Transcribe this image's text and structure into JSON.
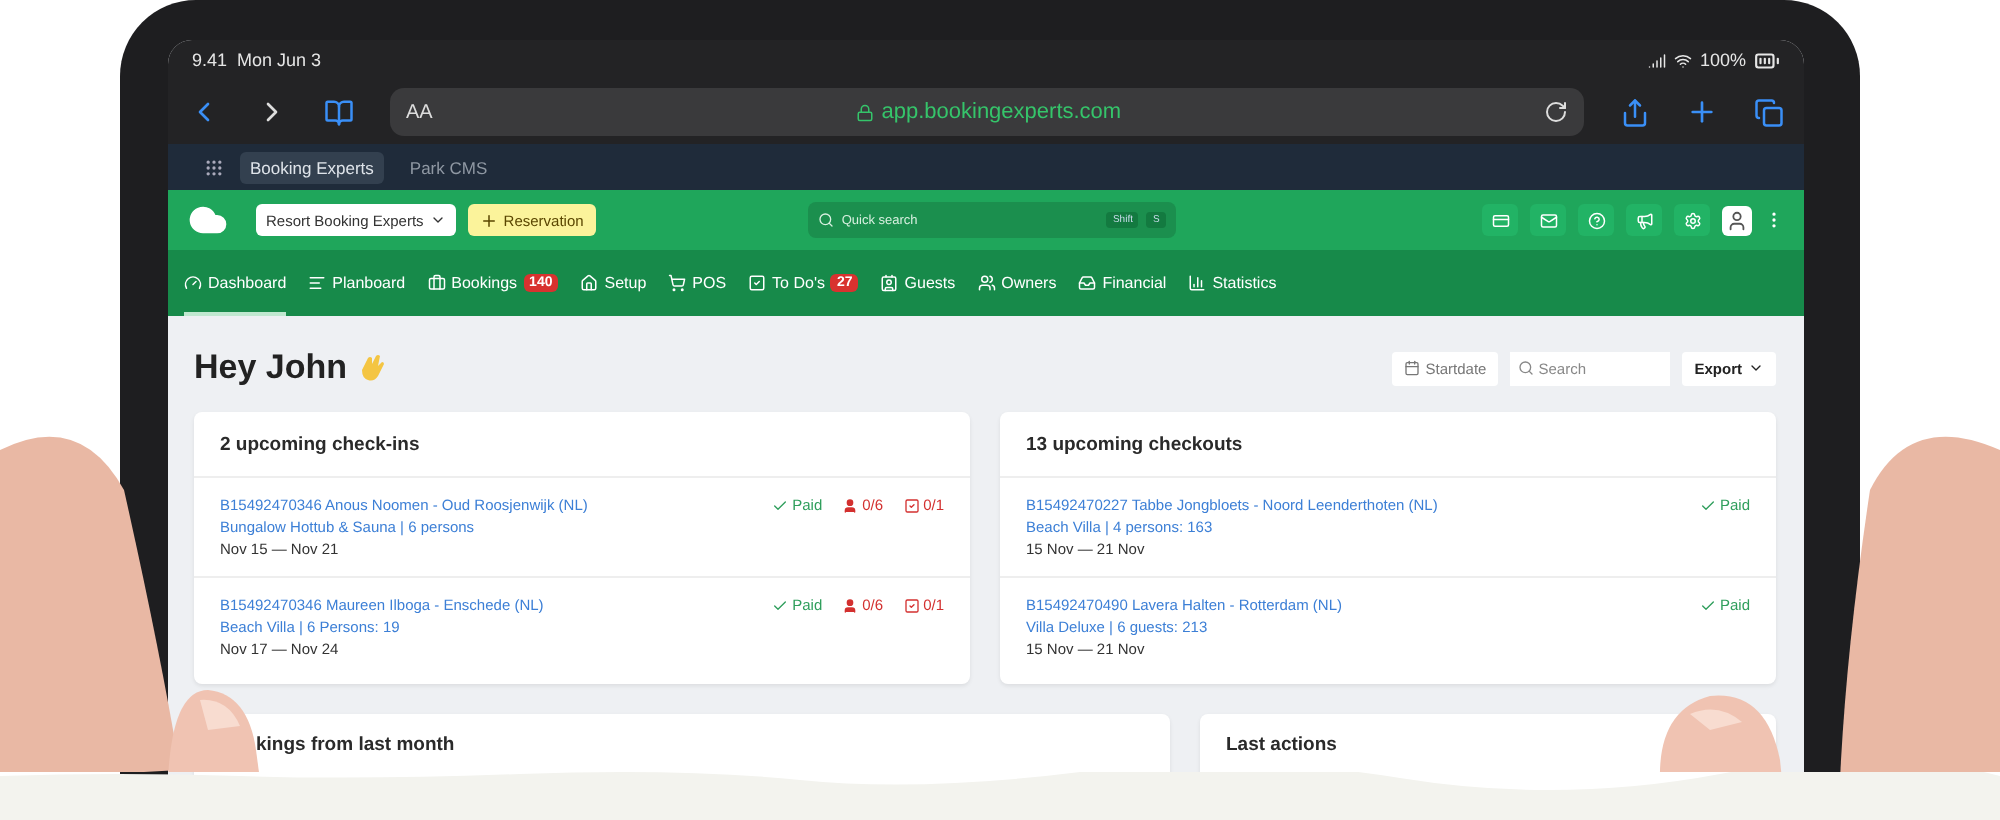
{
  "status_bar": {
    "time": "9.41",
    "date": "Mon Jun 3",
    "battery": "100%"
  },
  "browser": {
    "text_size": "AA",
    "url": "app.bookingexperts.com"
  },
  "bookmarks": [
    {
      "label": "Booking Experts",
      "selected": true
    },
    {
      "label": "Park CMS",
      "selected": false
    }
  ],
  "header": {
    "organization": "Resort Booking Experts",
    "action": "Reservation",
    "search_placeholder": "Quick search",
    "shortcut": [
      "Shift",
      "S"
    ]
  },
  "nav": [
    {
      "label": "Dashboard",
      "selected": true
    },
    {
      "label": "Planboard",
      "selected": false
    },
    {
      "label": "Bookings",
      "badge": "140",
      "selected": false
    },
    {
      "label": "Setup",
      "selected": false
    },
    {
      "label": "POS",
      "selected": false
    },
    {
      "label": "To Do's",
      "badge": "27",
      "selected": false
    },
    {
      "label": "Guests",
      "selected": false
    },
    {
      "label": "Owners",
      "selected": false
    },
    {
      "label": "Financial",
      "selected": false
    },
    {
      "label": "Statistics",
      "selected": false
    }
  ],
  "page": {
    "title": "Hey John",
    "startdate": "Startdate",
    "search_placeholder": "Search",
    "export": "Export"
  },
  "checkins": {
    "title": "2 upcoming check-ins",
    "rows": [
      {
        "booking": "B15492470346 Anous Noomen - Oud Roosjenwijk (NL)",
        "detail": "Bungalow Hottub & Sauna | 6 persons",
        "dates": "Nov 15 — Nov 21",
        "payment": "Paid",
        "guests": "0/6",
        "tasks": "0/1"
      },
      {
        "booking": "B15492470346 Maureen Ilboga - Enschede (NL)",
        "detail": "Beach Villa | 6 Persons: 19",
        "dates": "Nov 17 — Nov 24",
        "payment": "Paid",
        "guests": "0/6",
        "tasks": "0/1"
      }
    ]
  },
  "checkouts": {
    "title": "13 upcoming checkouts",
    "rows": [
      {
        "booking": "B15492470227 Tabbe Jongbloets - Noord Leenderthoten (NL)",
        "detail": "Beach Villa | 4 persons: 163",
        "dates": "15 Nov — 21 Nov",
        "payment": "Paid"
      },
      {
        "booking": "B15492470490 Lavera Halten - Rotterdam (NL)",
        "detail": "Villa Deluxe | 6 guests: 213",
        "dates": "15 Nov — 21 Nov",
        "payment": "Paid"
      }
    ]
  },
  "bottom_cards": [
    {
      "title": "kings from last month"
    },
    {
      "title": "Last actions"
    }
  ]
}
